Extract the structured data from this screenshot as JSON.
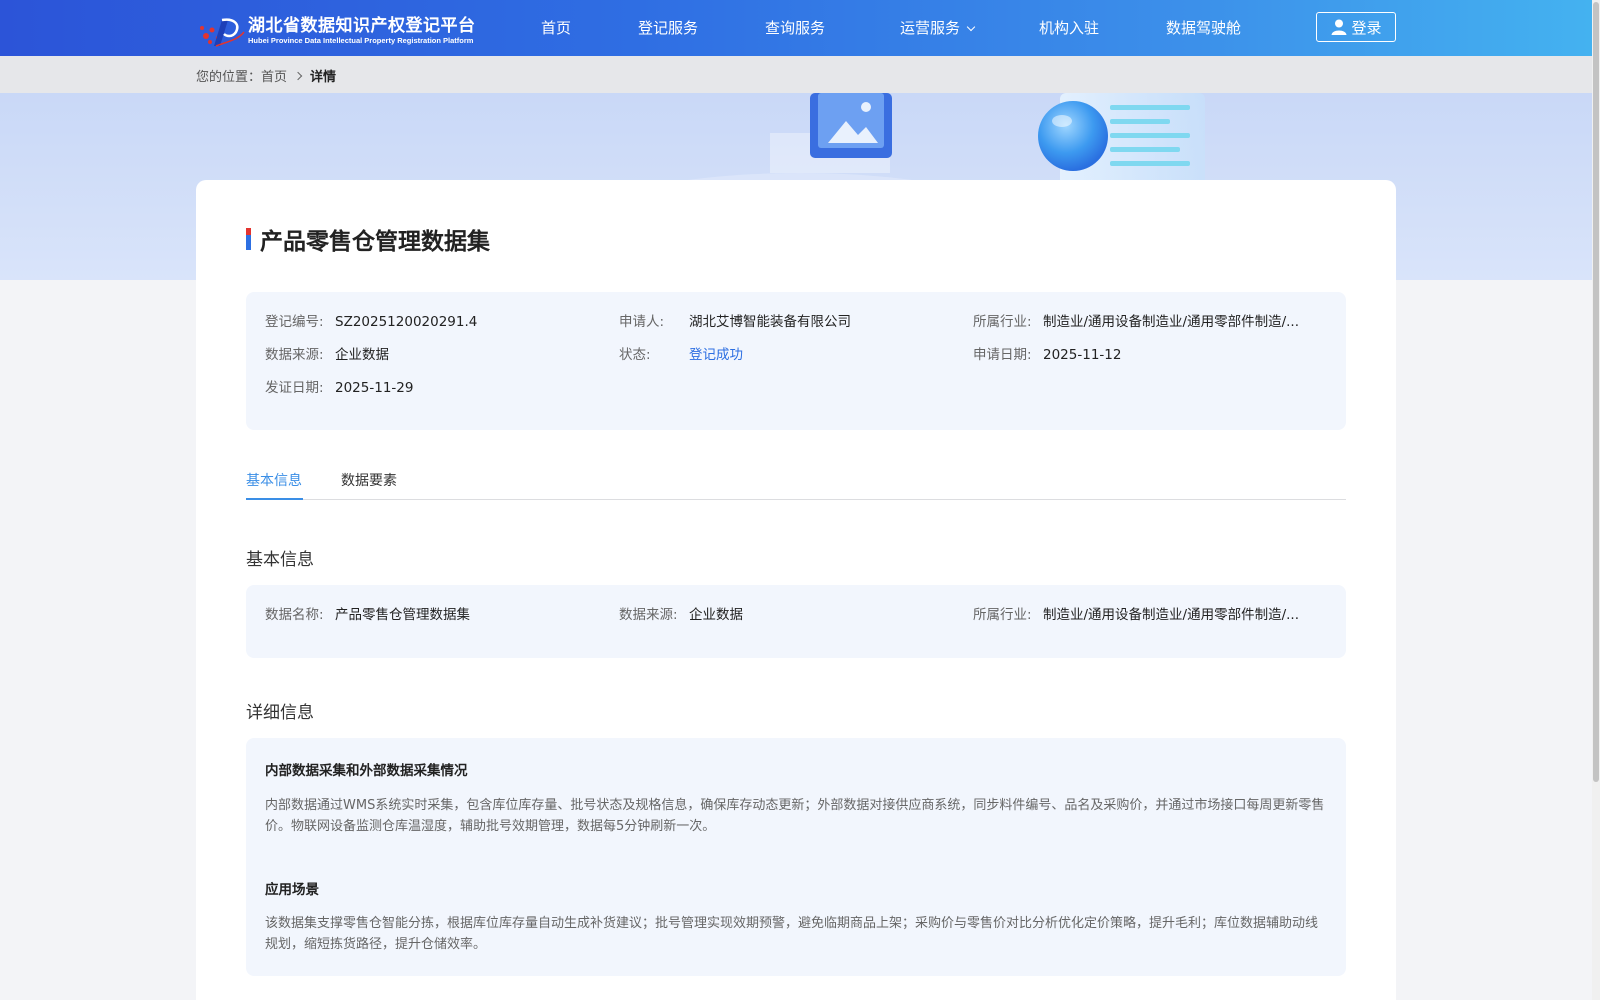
{
  "header": {
    "brand_cn": "湖北省数据知识产权登记平台",
    "brand_en": "Hubei Province Data Intellectual Property Registration Platform",
    "nav": [
      "首页",
      "登记服务",
      "查询服务",
      "运营服务",
      "机构入驻",
      "数据驾驶舱"
    ],
    "login_label": "登录"
  },
  "breadcrumb": {
    "prefix": "您的位置：",
    "home": "首页",
    "current": "详情"
  },
  "title": "产品零售仓管理数据集",
  "summary": {
    "reg_no_label": "登记编号:",
    "reg_no": "SZ2025120020291.4",
    "applicant_label": "申请人:",
    "applicant": "湖北艾博智能装备有限公司",
    "industry_label": "所属行业:",
    "industry": "制造业/通用设备制造业/通用零部件制造/...",
    "source_label": "数据来源:",
    "source": "企业数据",
    "status_label": "状态:",
    "status": "登记成功",
    "apply_date_label": "申请日期:",
    "apply_date": "2025-11-12",
    "issue_date_label": "发证日期:",
    "issue_date": "2025-11-29"
  },
  "tabs": [
    "基本信息",
    "数据要素"
  ],
  "basic": {
    "section_title": "基本信息",
    "name_label": "数据名称:",
    "name": "产品零售仓管理数据集",
    "source_label": "数据来源:",
    "source": "企业数据",
    "industry_label": "所属行业:",
    "industry": "制造业/通用设备制造业/通用零部件制造/..."
  },
  "detail": {
    "section_title": "详细信息",
    "collection_title": "内部数据采集和外部数据采集情况",
    "collection_text": "内部数据通过WMS系统实时采集，包含库位库存量、批号状态及规格信息，确保库存动态更新；外部数据对接供应商系统，同步料件编号、品名及采购价，并通过市场接口每周更新零售价。物联网设备监测仓库温湿度，辅助批号效期管理，数据每5分钟刷新一次。",
    "scenario_title": "应用场景",
    "scenario_text": "该数据集支撑零售仓智能分拣，根据库位库存量自动生成补货建议；批号管理实现效期预警，避免临期商品上架；采购价与零售价对比分析优化定价策略，提升毛利；库位数据辅助动线规划，缩短拣货路径，提升仓储效率。"
  },
  "colors": {
    "accent": "#3a8ee6",
    "status_success": "#2d6fe2",
    "header_start": "#2c54d8",
    "header_end": "#44b2f0"
  }
}
